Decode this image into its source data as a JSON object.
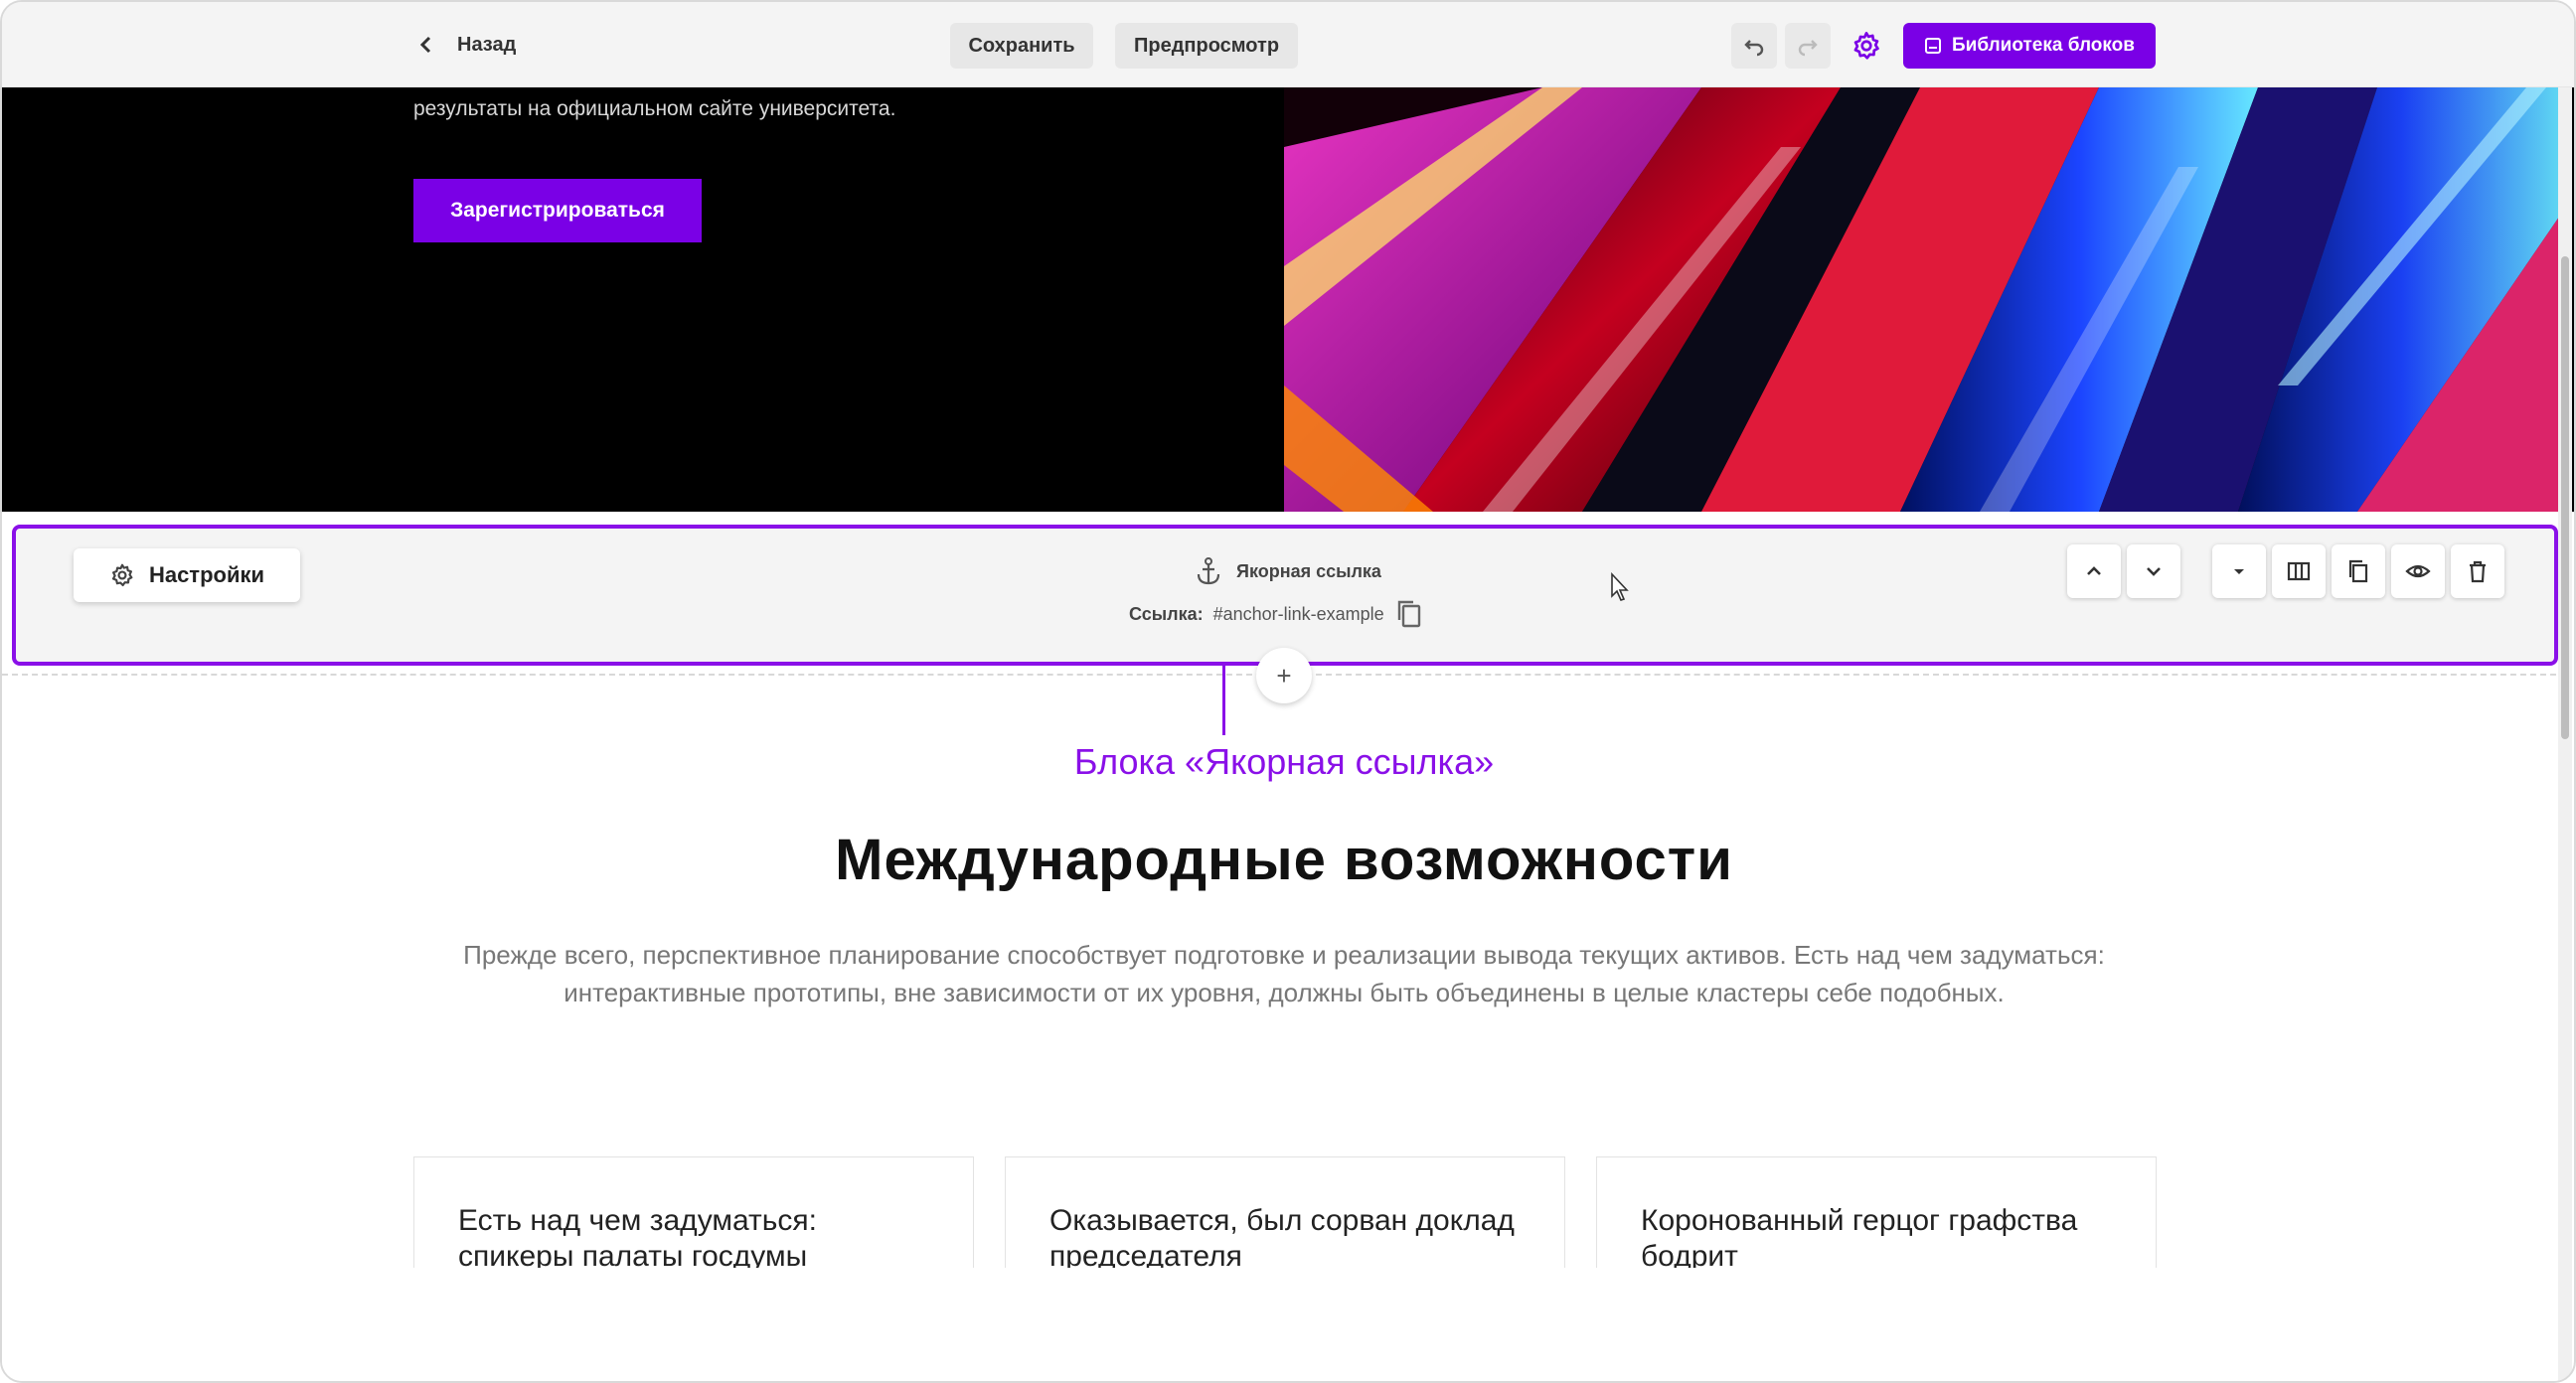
{
  "toolbar": {
    "back_label": "Назад",
    "save_label": "Сохранить",
    "preview_label": "Предпросмотр",
    "library_label": "Библиотека блоков",
    "accent_color": "#7a00e6"
  },
  "hero": {
    "text_line": "результаты на официальном сайте университета.",
    "register_label": "Зарегистрироваться"
  },
  "anchor_block": {
    "settings_label": "Настройки",
    "title": "Якорная ссылка",
    "link_prefix": "Ссылка:",
    "link_value": "#anchor-link-example",
    "border_color": "#8a10e8"
  },
  "add_button_label": "+",
  "callout": "Блока «Якорная ссылка»",
  "section": {
    "heading": "Международные возможности",
    "paragraph": "Прежде всего, перспективное планирование способствует подготовке и реализации вывода текущих активов. Есть над чем задуматься: интерактивные прототипы, вне зависимости от их уровня, должны быть объединены в целые кластеры себе подобных.",
    "cards": [
      {
        "title": "Есть над чем задуматься: спикеры палаты госдумы"
      },
      {
        "title": "Оказывается, был сорван доклад председателя"
      },
      {
        "title": "Коронованный герцог графства бодрит"
      }
    ]
  }
}
